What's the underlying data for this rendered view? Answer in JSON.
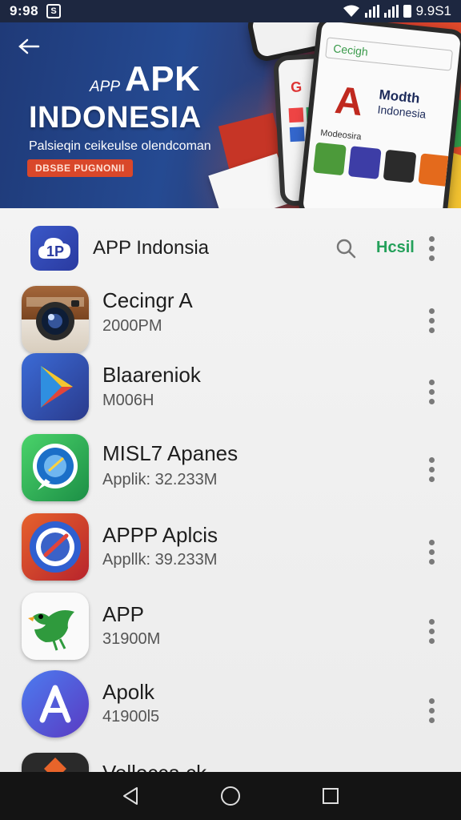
{
  "status_bar": {
    "time": "9:98",
    "notification_glyph": "S",
    "right_text": "9.9S1"
  },
  "banner": {
    "kicker": "APP",
    "apk": "APK",
    "title": "INDONESIA",
    "subtitle": "Palsieqin ceikeulse olendcoman",
    "cta_label": "DBSBE PUGNONII",
    "phone_search": "Cecigh",
    "phone_brand": "Modth",
    "phone_brand_sub": "Indonesia",
    "phone_caption": "Modeosira",
    "bg_start": "#1f3a78",
    "bg_end": "#e8502a"
  },
  "header": {
    "app_title": "APP Indonsia",
    "result_label": "Hcsil",
    "logo_text": "1P",
    "accent_color": "#24a05a"
  },
  "apps": [
    {
      "name": "Cecingr A",
      "meta": "2000PM",
      "icon": "camera-app-icon"
    },
    {
      "name": "Blaareniok",
      "meta": "M006H",
      "icon": "play-store-icon"
    },
    {
      "name": "MISL7 Apanes",
      "meta": "Applik: 32.233M",
      "icon": "safari-compass-icon"
    },
    {
      "name": "APPP Aplcis",
      "meta": "Appllk: 39.233M",
      "icon": "target-app-icon"
    },
    {
      "name": "APP",
      "meta": "31900M",
      "icon": "bird-app-icon"
    },
    {
      "name": "Apolk",
      "meta": "41900l5",
      "icon": "app-store-icon"
    },
    {
      "name": "Vellocca ck",
      "meta": "",
      "icon": "partial-app-icon"
    }
  ],
  "navbar": {
    "back": "back-nav-icon",
    "home": "home-nav-icon",
    "recents": "recents-nav-icon"
  }
}
